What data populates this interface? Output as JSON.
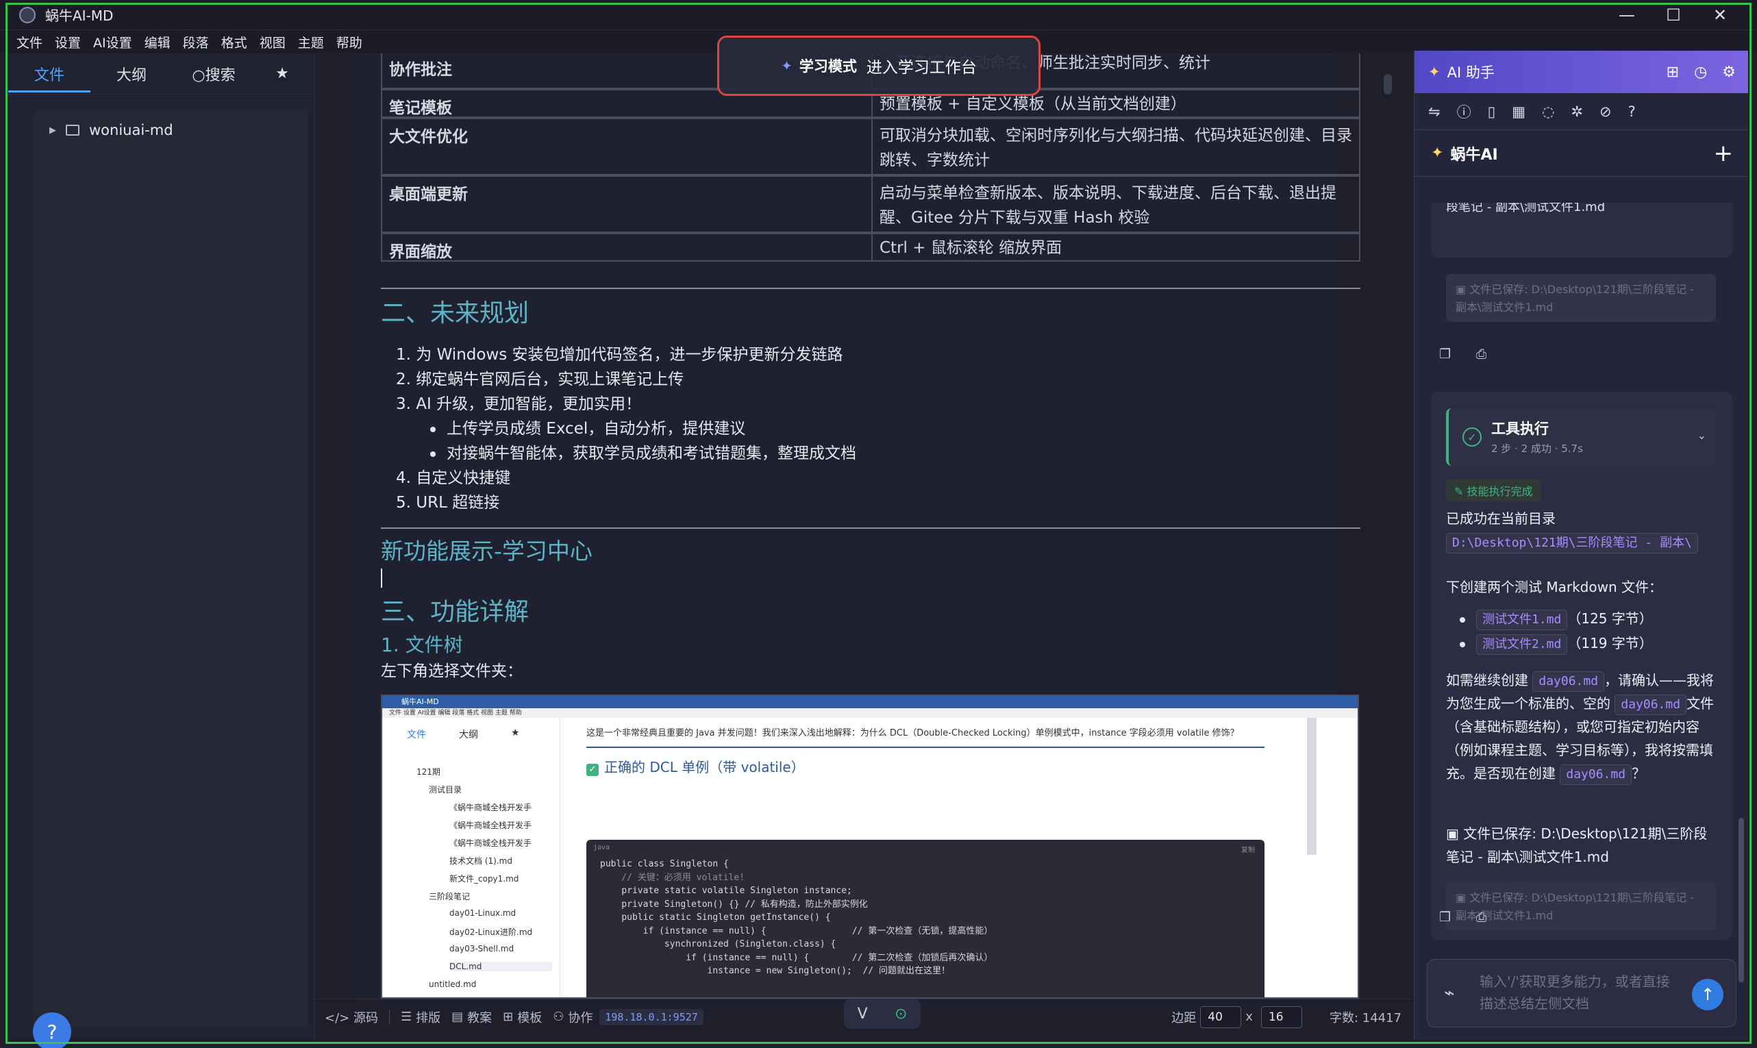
{
  "window": {
    "title": "蜗牛AI-MD",
    "controls": [
      "—",
      "☐",
      "✕"
    ]
  },
  "menu": [
    "文件",
    "设置",
    "AI设置",
    "编辑",
    "段落",
    "格式",
    "视图",
    "主题",
    "帮助"
  ],
  "left_panel": {
    "tabs": [
      "文件",
      "大纲",
      "搜索",
      "★"
    ],
    "tree_root": "woniuai-md",
    "help": "?"
  },
  "study_banner": {
    "mode": "学习模式",
    "action": "进入学习工作台"
  },
  "doc": {
    "table": [
      {
        "k": "协作批注",
        "v": "…开连接与自动命名、师生批注实时同步、统计"
      },
      {
        "k": "笔记模板",
        "v": "预置模板 + 自定义模板（从当前文档创建）"
      },
      {
        "k": "大文件优化",
        "v": "可取消分块加载、空闲时序列化与大纲扫描、代码块延迟创建、目录跳转、字数统计"
      },
      {
        "k": "桌面端更新",
        "v": "启动与菜单检查新版本、版本说明、下载进度、后台下载、退出提醒、Gitee 分片下载与双重 Hash 校验"
      },
      {
        "k": "界面缩放",
        "v": "Ctrl + 鼠标滚轮 缩放界面"
      }
    ],
    "future_title": "二、未来规划",
    "future_list": [
      "1. 为 Windows 安装包增加代码签名，进一步保护更新分发链路",
      "2. 绑定蜗牛官网后台，实现上课笔记上传",
      "3. AI 升级，更加智能，更加实用！",
      "4. 自定义快捷键",
      "5. URL 超链接"
    ],
    "ai_sub": [
      "上传学员成绩 Excel，自动分析，提供建议",
      "对接蜗牛智能体，获取学员成绩和考试错题集，整理成文档"
    ],
    "new_feature": "新功能展示-学习中心",
    "detail_title": "三、功能详解",
    "file_tree_title": "1. 文件树",
    "file_tree_desc": "左下角选择文件夹："
  },
  "shot": {
    "title": "蜗牛AI-MD",
    "menu": "文件  设置  AI设置  编辑  段落  格式  视图  主题  帮助",
    "tabs": [
      "文件",
      "大纲",
      "★"
    ],
    "tree": [
      "121期",
      "测试目录",
      "《蜗牛商城全栈开发手",
      "《蜗牛商城全栈开发手",
      "《蜗牛商城全栈开发手",
      "技术文档 (1).md",
      "新文件_copy1.md",
      "三阶段笔记",
      "day01-Linux.md",
      "day02-Linux进阶.md",
      "day03-Shell.md",
      "DCL.md",
      "untitled.md"
    ],
    "intro": "这是一个非常经典且重要的 Java 并发问题！我们来深入浅出地解释：为什么 DCL（Double-Checked Locking）单例模式中，instance 字段必须用 volatile 修饰？",
    "heading": "正确的 DCL 单例（带 volatile）",
    "code_lang": "java",
    "copy": "复制",
    "code": [
      "public class Singleton {",
      "    // 关键：必须用 volatile!",
      "    private static volatile Singleton instance;",
      "",
      "    private Singleton() {} // 私有构造，防止外部实例化",
      "",
      "    public static Singleton getInstance() {",
      "        if (instance == null) {                // 第一次检查（无锁，提高性能）",
      "            synchronized (Singleton.class) {",
      "                if (instance == null) {        // 第二次检查（加锁后再次确认）",
      "                    instance = new Singleton();  // 问题就出在这里！"
    ]
  },
  "statusbar": {
    "source": "</> 源码",
    "layout": "排版",
    "lesson": "教案",
    "template": "模板",
    "collab": "协作",
    "ip": "198.18.0.1:9527",
    "margin_label": "边距",
    "margin_value": "40",
    "x": "x",
    "margin_value2": "16",
    "word_count": "字数: 14417"
  },
  "ai": {
    "header": "AI 助手",
    "sub": "蜗牛AI",
    "saved_top_tail": "段笔记 - 副本\\测试文件1.md",
    "saved_box1": "文件已保存: D:\\Desktop\\121期\\三阶段笔记 - 副本\\测试文件1.md",
    "tool_title": "工具执行",
    "tool_sub": "2 步 · 2 成功 · 5.7s",
    "skill": "技能执行完成",
    "msg1": "已成功在当前目录",
    "path": "D:\\Desktop\\121期\\三阶段笔记 - 副本\\",
    "msg2": "下创建两个测试 Markdown 文件：",
    "file1": "测试文件1.md",
    "file1_size": "（125 字节）",
    "file2": "测试文件2.md",
    "file2_size": "（119 字节）",
    "msg3a": "如需继续创建",
    "day06": "day06.md",
    "msg3b": "，请确认——我将为您生成一个标准的、空的",
    "msg3c": "文件（含基础标题结构），或您可指定初始内容（例如课程主题、学习目标等），我将按需填充。是否现在创建",
    "msg3d": "？",
    "saved_msg": "文件已保存: D:\\Desktop\\121期\\三阶段笔记 - 副本\\测试文件1.md",
    "saved_box2": "文件已保存: D:\\Desktop\\121期\\三阶段笔记 - 副本\\测试文件1.md",
    "input_placeholder": "输入'/'获取更多能力，或者直接描述总结左侧文档"
  }
}
